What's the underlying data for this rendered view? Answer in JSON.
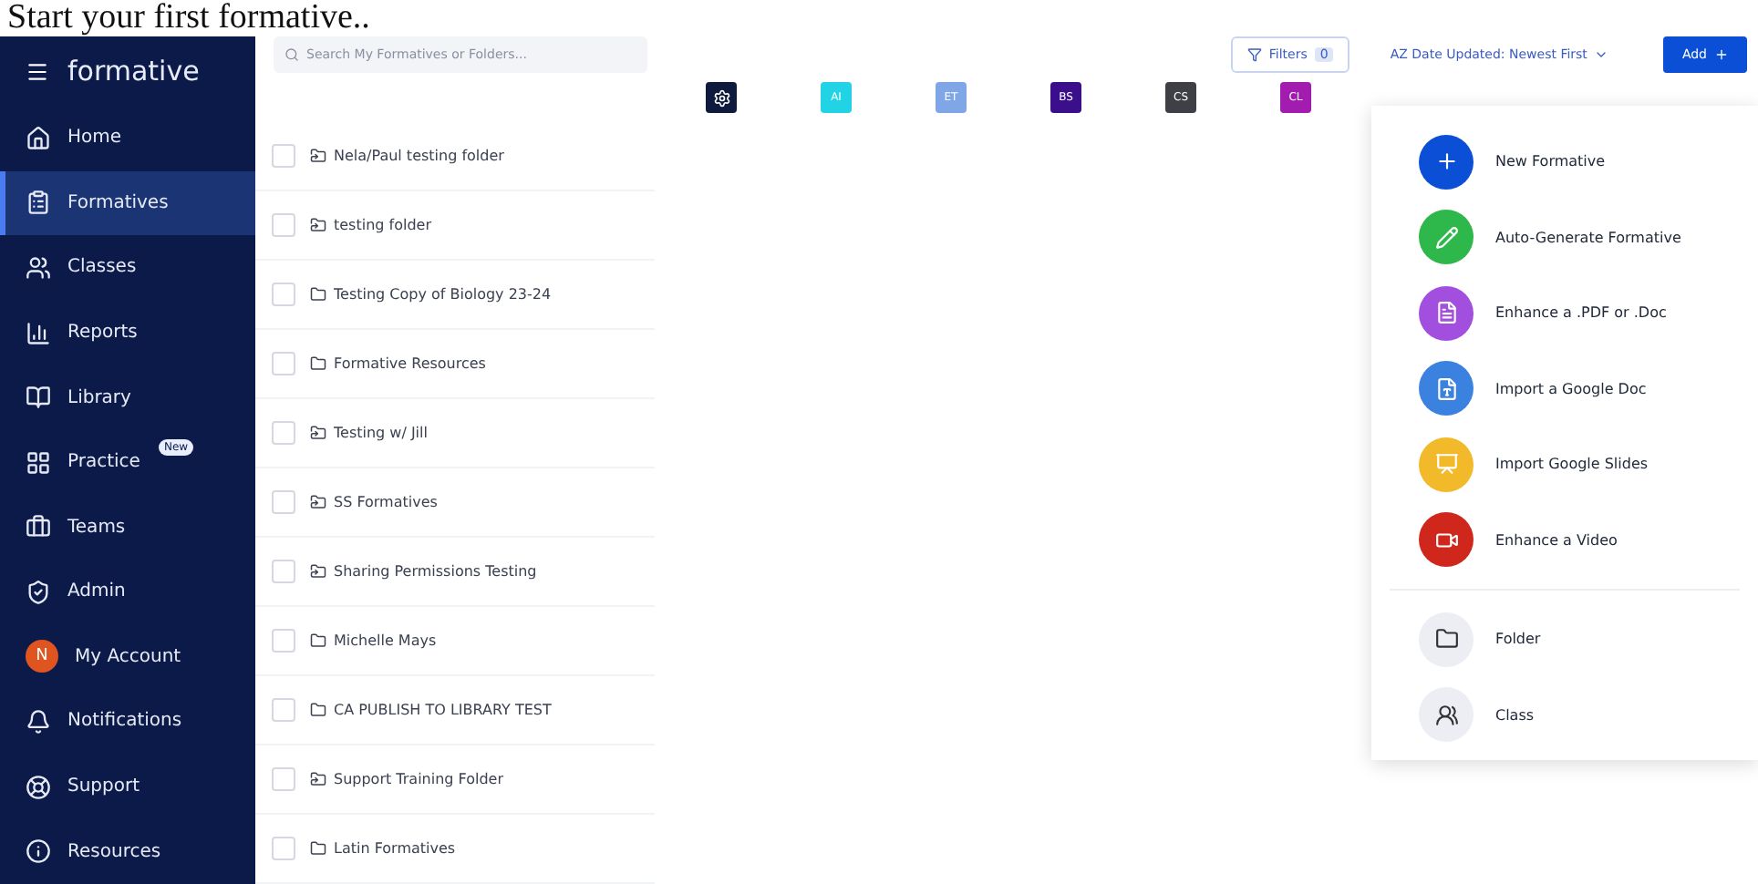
{
  "caption": "Start your first formative..",
  "sidebar": {
    "logo": "formative",
    "items": [
      {
        "label": "Home",
        "selected": false
      },
      {
        "label": "Formatives",
        "selected": true
      },
      {
        "label": "Classes",
        "selected": false
      },
      {
        "label": "Reports",
        "selected": false
      },
      {
        "label": "Library",
        "selected": false
      },
      {
        "label": "Practice",
        "selected": false,
        "badge": "New"
      },
      {
        "label": "Teams",
        "selected": false
      },
      {
        "label": "Admin",
        "selected": false
      },
      {
        "label": "My Account",
        "selected": false,
        "avatar": "N"
      },
      {
        "label": "Notifications",
        "selected": false
      },
      {
        "label": "Support",
        "selected": false
      },
      {
        "label": "Resources",
        "selected": false
      }
    ]
  },
  "search": {
    "placeholder": "Search My Formatives or Folders..."
  },
  "toolbar": {
    "filters": "Filters",
    "filter_count": "0",
    "sort_prefix": "AZ",
    "sort": "Date Updated: Newest First",
    "add": "Add"
  },
  "columns": [
    {
      "kind": "icon",
      "color": "#0f1b3d"
    },
    {
      "kind": "text",
      "label": "AI",
      "color": "#22d3e6"
    },
    {
      "kind": "text",
      "label": "ET",
      "color": "#7fa7e8"
    },
    {
      "kind": "text",
      "label": "BS",
      "color": "#3b0f8c"
    },
    {
      "kind": "text",
      "label": "CS",
      "color": "#3f3f46"
    },
    {
      "kind": "text",
      "label": "CL",
      "color": "#a21caf"
    }
  ],
  "folders": [
    {
      "name": "Nela/Paul testing folder",
      "kind": "shared",
      "checked": false
    },
    {
      "name": "testing folder",
      "kind": "shared",
      "checked": false
    },
    {
      "name": "Testing Copy of Biology 23-24",
      "kind": "plain",
      "checked": false
    },
    {
      "name": "Formative Resources",
      "kind": "plain",
      "checked": false
    },
    {
      "name": "Testing w/ Jill",
      "kind": "shared",
      "checked": false
    },
    {
      "name": "SS Formatives",
      "kind": "shared",
      "checked": false
    },
    {
      "name": "Sharing Permissions Testing",
      "kind": "shared",
      "checked": false
    },
    {
      "name": "Michelle Mays",
      "kind": "plain",
      "checked": false
    },
    {
      "name": "CA PUBLISH TO LIBRARY TEST",
      "kind": "plain",
      "checked": false
    },
    {
      "name": "Support Training Folder",
      "kind": "shared",
      "checked": false
    },
    {
      "name": "Latin Formatives",
      "kind": "plain",
      "checked": false
    }
  ],
  "add_menu": {
    "items": [
      {
        "label": "New Formative",
        "color": "#0b4fd6",
        "kind": "plus"
      },
      {
        "label": "Auto-Generate Formative",
        "color": "#2eb84b",
        "kind": "pencil"
      },
      {
        "label": "Enhance a .PDF or .Doc",
        "color": "#a24fe0",
        "kind": "file"
      },
      {
        "label": "Import a Google Doc",
        "color": "#3b82e0",
        "kind": "doc"
      },
      {
        "label": "Import Google Slides",
        "color": "#f2b92a",
        "kind": "slides"
      },
      {
        "label": "Enhance a Video",
        "color": "#d0271d",
        "kind": "video"
      }
    ],
    "secondary": [
      {
        "label": "Folder",
        "kind": "folder"
      },
      {
        "label": "Class",
        "kind": "class"
      }
    ]
  }
}
